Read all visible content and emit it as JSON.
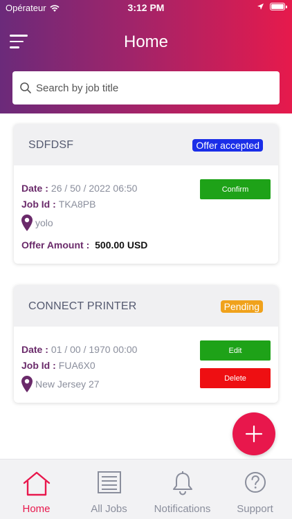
{
  "status_bar": {
    "carrier": "Opérateur",
    "time": "3:12 PM"
  },
  "header": {
    "title": "Home"
  },
  "search": {
    "placeholder": "Search by job title"
  },
  "jobs": [
    {
      "title": "SDFDSF",
      "status": "Offer accepted",
      "status_color": "#1a2ee8",
      "date_label": "Date :",
      "date": "26 / 50 / 2022 06:50",
      "job_id_label": "Job Id :",
      "job_id": "TKA8PB",
      "location": "yolo",
      "offer_label": "Offer Amount :",
      "offer_amount": "500.00 USD",
      "buttons": [
        "Confirm"
      ]
    },
    {
      "title": "CONNECT PRINTER",
      "status": "Pending",
      "status_color": "#f0a21c",
      "date_label": "Date :",
      "date": "01 / 00 / 1970 00:00",
      "job_id_label": "Job Id :",
      "job_id": "FUA6X0",
      "location": "New Jersey 27",
      "buttons": [
        "Edit",
        "Delete"
      ]
    }
  ],
  "tabs": [
    {
      "label": "Home",
      "icon": "home-icon",
      "active": true
    },
    {
      "label": "All Jobs",
      "icon": "list-icon",
      "active": false
    },
    {
      "label": "Notifications",
      "icon": "bell-icon",
      "active": false
    },
    {
      "label": "Support",
      "icon": "help-icon",
      "active": false
    }
  ],
  "colors": {
    "accent": "#e8174c",
    "confirm": "#1ea218",
    "delete": "#ee0f12",
    "label": "#6a2a6a"
  }
}
